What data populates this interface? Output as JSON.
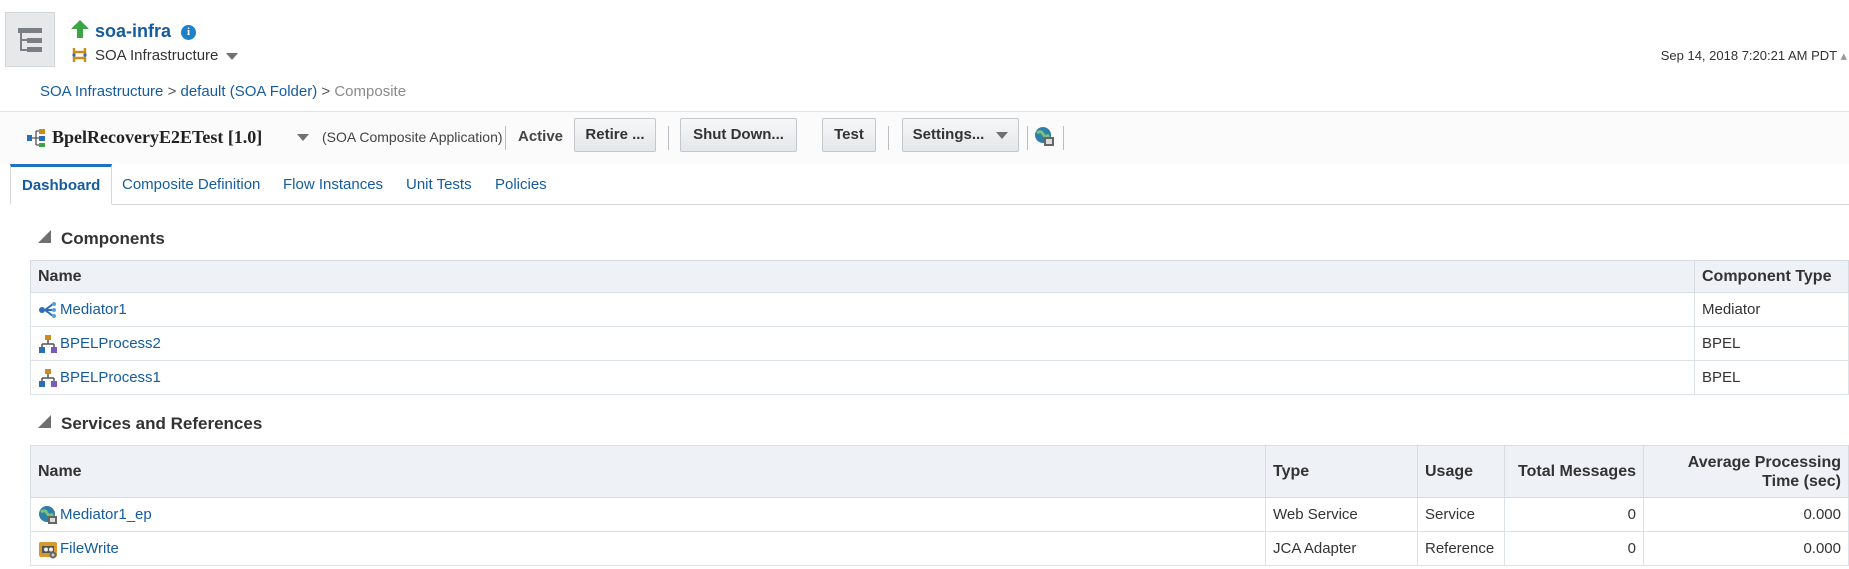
{
  "header": {
    "app_title": "soa-infra",
    "target_menu": "SOA Infrastructure",
    "timestamp": "Sep 14, 2018 7:20:21 AM PDT"
  },
  "breadcrumb": {
    "items": [
      "SOA Infrastructure",
      "default (SOA Folder)"
    ],
    "separator": ">",
    "current": "Composite"
  },
  "toolbar": {
    "composite_name": "BpelRecoveryE2ETest [1.0]",
    "composite_type": "(SOA Composite Application)",
    "state": "Active",
    "retire_label": "Retire ...",
    "shutdown_label": "Shut Down...",
    "test_label": "Test",
    "settings_label": "Settings..."
  },
  "tabs": [
    {
      "label": "Dashboard",
      "active": true
    },
    {
      "label": "Composite Definition",
      "active": false
    },
    {
      "label": "Flow Instances",
      "active": false
    },
    {
      "label": "Unit Tests",
      "active": false
    },
    {
      "label": "Policies",
      "active": false
    }
  ],
  "components": {
    "title": "Components",
    "columns": [
      "Name",
      "Component Type"
    ],
    "rows": [
      {
        "name": "Mediator1",
        "type": "Mediator",
        "icon": "mediator-icon"
      },
      {
        "name": "BPELProcess2",
        "type": "BPEL",
        "icon": "bpel-process-icon"
      },
      {
        "name": "BPELProcess1",
        "type": "BPEL",
        "icon": "bpel-process-icon"
      }
    ]
  },
  "services": {
    "title": "Services and References",
    "columns": [
      "Name",
      "Type",
      "Usage",
      "Total Messages",
      "Average Processing Time (sec)"
    ],
    "rows": [
      {
        "name": "Mediator1_ep",
        "type": "Web Service",
        "usage": "Service",
        "total": "0",
        "avg": "0.000",
        "icon": "web-service-icon"
      },
      {
        "name": "FileWrite",
        "type": "JCA Adapter",
        "usage": "Reference",
        "total": "0",
        "avg": "0.000",
        "icon": "jca-adapter-icon"
      }
    ]
  },
  "colors": {
    "link": "#145c9e",
    "accent": "#1e70c0",
    "header_bg": "#eef2f6",
    "up_arrow": "#3aa542"
  }
}
